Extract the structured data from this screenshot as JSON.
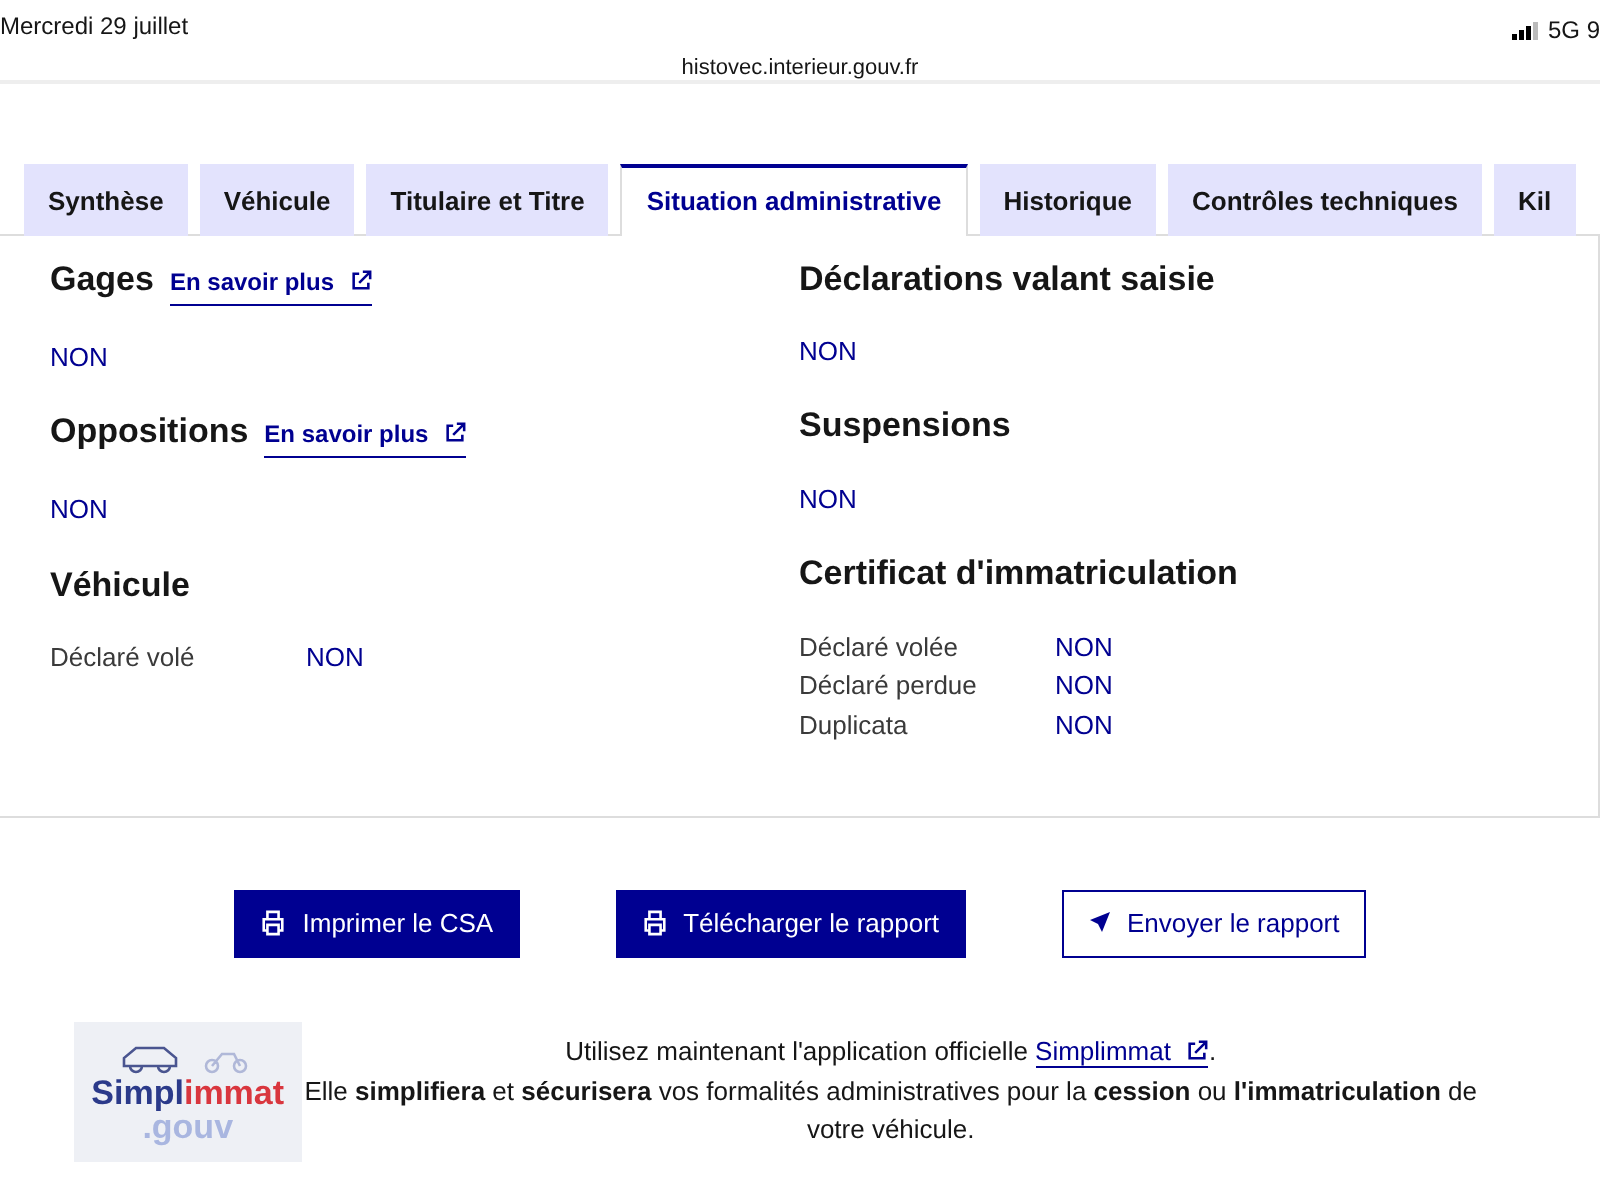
{
  "status_bar": {
    "date": "Mercredi 29 juillet",
    "network": "5G 9"
  },
  "address_bar": {
    "url": "histovec.interieur.gouv.fr"
  },
  "tabs": [
    {
      "label": "Synthèse",
      "selected": false
    },
    {
      "label": "Véhicule",
      "selected": false
    },
    {
      "label": "Titulaire et Titre",
      "selected": false
    },
    {
      "label": "Situation administrative",
      "selected": true
    },
    {
      "label": "Historique",
      "selected": false
    },
    {
      "label": "Contrôles techniques",
      "selected": false
    },
    {
      "label": "Kil",
      "selected": false
    }
  ],
  "columns": [
    [
      {
        "title": "Gages",
        "link": "En savoir plus",
        "kind": "single",
        "value": "NON"
      },
      {
        "title": "Oppositions",
        "link": "En savoir plus",
        "kind": "single",
        "value": "NON"
      },
      {
        "title": "Véhicule",
        "kind": "pairs",
        "rows": [
          {
            "label": "Déclaré volé",
            "value": "NON"
          }
        ]
      }
    ],
    [
      {
        "title": "Déclarations valant saisie",
        "kind": "single",
        "value": "NON"
      },
      {
        "title": "Suspensions",
        "kind": "single",
        "value": "NON"
      },
      {
        "title": "Certificat d'immatriculation",
        "kind": "pairs",
        "rows": [
          {
            "label": "Déclaré volée",
            "value": "NON"
          },
          {
            "label": "Déclaré perdue",
            "value": "NON"
          },
          {
            "label": "Duplicata",
            "value": "NON"
          }
        ]
      }
    ]
  ],
  "buttons": [
    {
      "label": "Imprimer le CSA",
      "kind": "primary"
    },
    {
      "label": "Télécharger le rapport",
      "kind": "primary"
    },
    {
      "label": "Envoyer le rapport",
      "kind": "outline"
    }
  ],
  "promo": {
    "logo": {
      "part_1": "Simpl",
      "part_2": "immat",
      "suffix": ".gouv"
    },
    "text_before": "Utilisez maintenant l'application officielle ",
    "link": "Simplimmat",
    "text_after": ".\nElle **simplifiera** et **sécurisera** vos formalités administratives pour la **cession** ou **l'immatriculation** de votre véhicule."
  }
}
